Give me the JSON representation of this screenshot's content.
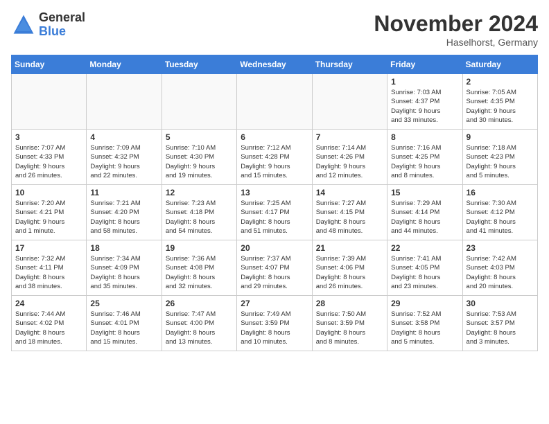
{
  "logo": {
    "general": "General",
    "blue": "Blue"
  },
  "title": "November 2024",
  "location": "Haselhorst, Germany",
  "weekdays": [
    "Sunday",
    "Monday",
    "Tuesday",
    "Wednesday",
    "Thursday",
    "Friday",
    "Saturday"
  ],
  "weeks": [
    [
      {
        "day": "",
        "info": ""
      },
      {
        "day": "",
        "info": ""
      },
      {
        "day": "",
        "info": ""
      },
      {
        "day": "",
        "info": ""
      },
      {
        "day": "",
        "info": ""
      },
      {
        "day": "1",
        "info": "Sunrise: 7:03 AM\nSunset: 4:37 PM\nDaylight: 9 hours\nand 33 minutes."
      },
      {
        "day": "2",
        "info": "Sunrise: 7:05 AM\nSunset: 4:35 PM\nDaylight: 9 hours\nand 30 minutes."
      }
    ],
    [
      {
        "day": "3",
        "info": "Sunrise: 7:07 AM\nSunset: 4:33 PM\nDaylight: 9 hours\nand 26 minutes."
      },
      {
        "day": "4",
        "info": "Sunrise: 7:09 AM\nSunset: 4:32 PM\nDaylight: 9 hours\nand 22 minutes."
      },
      {
        "day": "5",
        "info": "Sunrise: 7:10 AM\nSunset: 4:30 PM\nDaylight: 9 hours\nand 19 minutes."
      },
      {
        "day": "6",
        "info": "Sunrise: 7:12 AM\nSunset: 4:28 PM\nDaylight: 9 hours\nand 15 minutes."
      },
      {
        "day": "7",
        "info": "Sunrise: 7:14 AM\nSunset: 4:26 PM\nDaylight: 9 hours\nand 12 minutes."
      },
      {
        "day": "8",
        "info": "Sunrise: 7:16 AM\nSunset: 4:25 PM\nDaylight: 9 hours\nand 8 minutes."
      },
      {
        "day": "9",
        "info": "Sunrise: 7:18 AM\nSunset: 4:23 PM\nDaylight: 9 hours\nand 5 minutes."
      }
    ],
    [
      {
        "day": "10",
        "info": "Sunrise: 7:20 AM\nSunset: 4:21 PM\nDaylight: 9 hours\nand 1 minute."
      },
      {
        "day": "11",
        "info": "Sunrise: 7:21 AM\nSunset: 4:20 PM\nDaylight: 8 hours\nand 58 minutes."
      },
      {
        "day": "12",
        "info": "Sunrise: 7:23 AM\nSunset: 4:18 PM\nDaylight: 8 hours\nand 54 minutes."
      },
      {
        "day": "13",
        "info": "Sunrise: 7:25 AM\nSunset: 4:17 PM\nDaylight: 8 hours\nand 51 minutes."
      },
      {
        "day": "14",
        "info": "Sunrise: 7:27 AM\nSunset: 4:15 PM\nDaylight: 8 hours\nand 48 minutes."
      },
      {
        "day": "15",
        "info": "Sunrise: 7:29 AM\nSunset: 4:14 PM\nDaylight: 8 hours\nand 44 minutes."
      },
      {
        "day": "16",
        "info": "Sunrise: 7:30 AM\nSunset: 4:12 PM\nDaylight: 8 hours\nand 41 minutes."
      }
    ],
    [
      {
        "day": "17",
        "info": "Sunrise: 7:32 AM\nSunset: 4:11 PM\nDaylight: 8 hours\nand 38 minutes."
      },
      {
        "day": "18",
        "info": "Sunrise: 7:34 AM\nSunset: 4:09 PM\nDaylight: 8 hours\nand 35 minutes."
      },
      {
        "day": "19",
        "info": "Sunrise: 7:36 AM\nSunset: 4:08 PM\nDaylight: 8 hours\nand 32 minutes."
      },
      {
        "day": "20",
        "info": "Sunrise: 7:37 AM\nSunset: 4:07 PM\nDaylight: 8 hours\nand 29 minutes."
      },
      {
        "day": "21",
        "info": "Sunrise: 7:39 AM\nSunset: 4:06 PM\nDaylight: 8 hours\nand 26 minutes."
      },
      {
        "day": "22",
        "info": "Sunrise: 7:41 AM\nSunset: 4:05 PM\nDaylight: 8 hours\nand 23 minutes."
      },
      {
        "day": "23",
        "info": "Sunrise: 7:42 AM\nSunset: 4:03 PM\nDaylight: 8 hours\nand 20 minutes."
      }
    ],
    [
      {
        "day": "24",
        "info": "Sunrise: 7:44 AM\nSunset: 4:02 PM\nDaylight: 8 hours\nand 18 minutes."
      },
      {
        "day": "25",
        "info": "Sunrise: 7:46 AM\nSunset: 4:01 PM\nDaylight: 8 hours\nand 15 minutes."
      },
      {
        "day": "26",
        "info": "Sunrise: 7:47 AM\nSunset: 4:00 PM\nDaylight: 8 hours\nand 13 minutes."
      },
      {
        "day": "27",
        "info": "Sunrise: 7:49 AM\nSunset: 3:59 PM\nDaylight: 8 hours\nand 10 minutes."
      },
      {
        "day": "28",
        "info": "Sunrise: 7:50 AM\nSunset: 3:59 PM\nDaylight: 8 hours\nand 8 minutes."
      },
      {
        "day": "29",
        "info": "Sunrise: 7:52 AM\nSunset: 3:58 PM\nDaylight: 8 hours\nand 5 minutes."
      },
      {
        "day": "30",
        "info": "Sunrise: 7:53 AM\nSunset: 3:57 PM\nDaylight: 8 hours\nand 3 minutes."
      }
    ]
  ]
}
